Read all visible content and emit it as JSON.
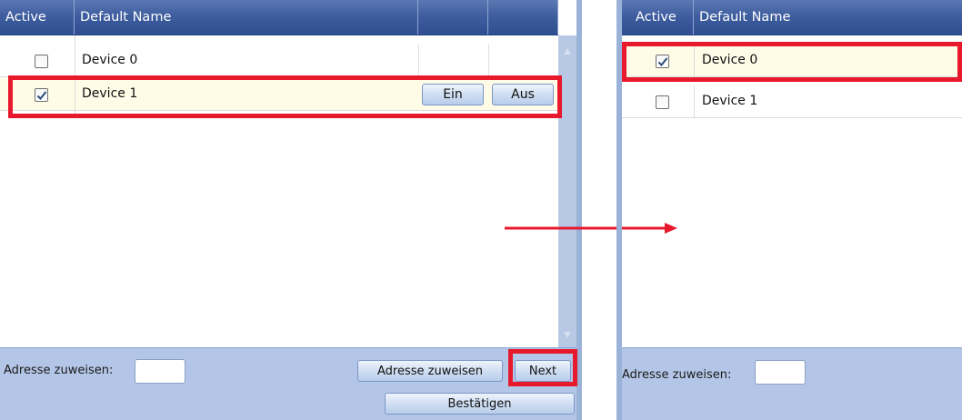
{
  "left": {
    "header": {
      "active": "Active",
      "name": "Default Name"
    },
    "rows": [
      {
        "checked": false,
        "name": "Device 0"
      },
      {
        "checked": true,
        "name": "Device 1"
      }
    ],
    "buttons": {
      "on": "Ein",
      "off": "Aus"
    },
    "footer": {
      "address_label": "Adresse zuweisen:",
      "assign_button": "Adresse zuweisen",
      "next_button": "Next",
      "confirm_button": "Bestätigen"
    }
  },
  "right": {
    "header": {
      "active": "Active",
      "name": "Default Name"
    },
    "rows": [
      {
        "checked": true,
        "name": "Device 0"
      },
      {
        "checked": false,
        "name": "Device 1"
      }
    ],
    "footer": {
      "address_label": "Adresse zuweisen:"
    }
  },
  "colors": {
    "header": "#3f5e9f",
    "highlight": "#e8192c",
    "selected_row": "#fefbe7",
    "footer": "#b4c6e7"
  },
  "icons": [
    "checkbox-icon",
    "checkmark-icon",
    "scroll-up-icon",
    "scroll-down-icon",
    "arrow-right-icon"
  ]
}
